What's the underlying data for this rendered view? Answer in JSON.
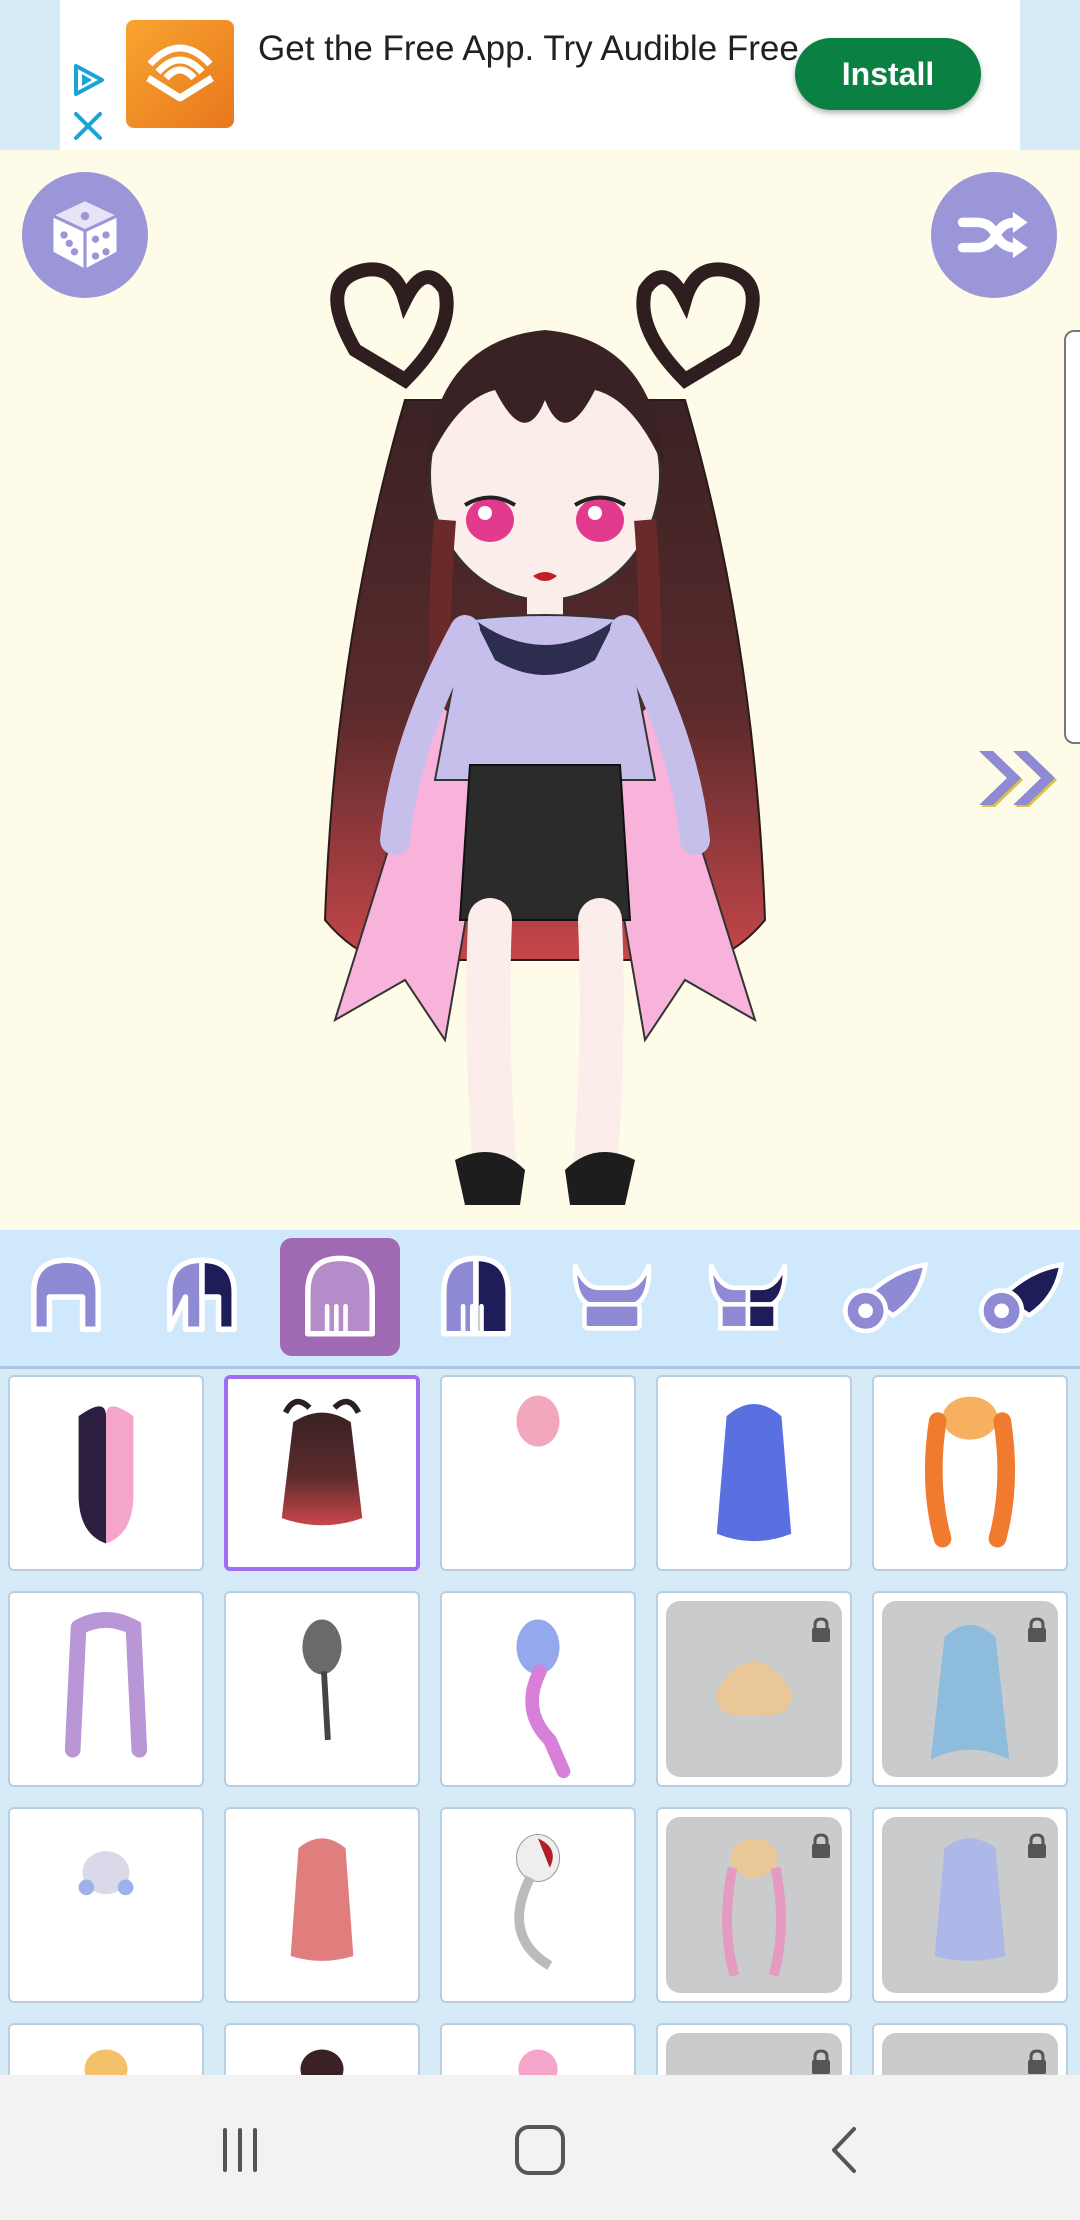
{
  "ad": {
    "text": "Get the Free App. Try Audible Free.",
    "install_label": "Install",
    "brand_color": "#f8a431",
    "button_color": "#0b8043"
  },
  "stage": {
    "randomize_icon": "dice-icon",
    "shuffle_icon": "shuffle-icon",
    "next_icon": "double-chevron-right-icon",
    "button_color": "#9b96d8"
  },
  "categories": [
    {
      "name": "hair-front",
      "active": false
    },
    {
      "name": "hair-front-color",
      "active": false
    },
    {
      "name": "hair-back",
      "active": true
    },
    {
      "name": "hair-back-color",
      "active": false
    },
    {
      "name": "horns",
      "active": false
    },
    {
      "name": "horns-color",
      "active": false
    },
    {
      "name": "wings",
      "active": false
    },
    {
      "name": "wings-color",
      "active": false
    }
  ],
  "items": [
    {
      "id": "hair-1",
      "locked": false,
      "selected": false
    },
    {
      "id": "hair-2",
      "locked": false,
      "selected": true
    },
    {
      "id": "hair-3",
      "locked": false,
      "selected": false
    },
    {
      "id": "hair-4",
      "locked": false,
      "selected": false
    },
    {
      "id": "hair-5",
      "locked": false,
      "selected": false
    },
    {
      "id": "hair-6",
      "locked": false,
      "selected": false
    },
    {
      "id": "hair-7",
      "locked": false,
      "selected": false
    },
    {
      "id": "hair-8",
      "locked": false,
      "selected": false
    },
    {
      "id": "hair-9",
      "locked": true,
      "selected": false
    },
    {
      "id": "hair-10",
      "locked": true,
      "selected": false
    },
    {
      "id": "hair-11",
      "locked": false,
      "selected": false
    },
    {
      "id": "hair-12",
      "locked": false,
      "selected": false
    },
    {
      "id": "hair-13",
      "locked": false,
      "selected": false
    },
    {
      "id": "hair-14",
      "locked": true,
      "selected": false
    },
    {
      "id": "hair-15",
      "locked": true,
      "selected": false
    }
  ],
  "nav": {
    "recents_icon": "recents-icon",
    "home_icon": "home-icon",
    "back_icon": "back-icon"
  }
}
